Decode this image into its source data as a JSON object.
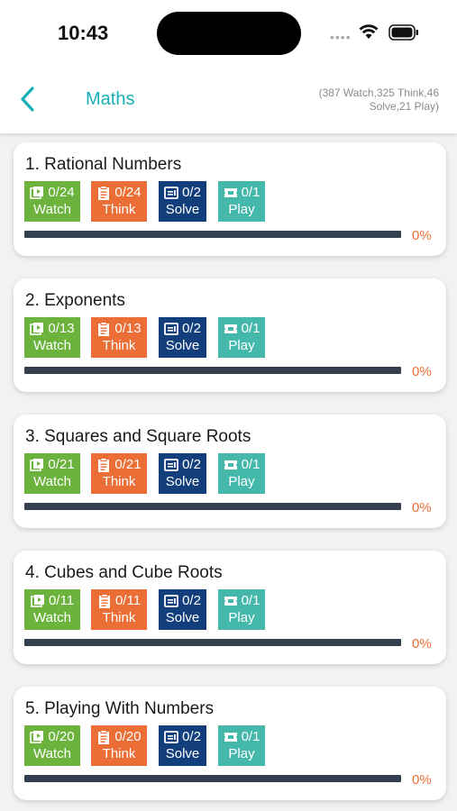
{
  "status": {
    "time": "10:43"
  },
  "header": {
    "title": "Maths",
    "summary_line1": "(387 Watch,325 Think,46",
    "summary_line2": "Solve,21 Play)"
  },
  "chapters": [
    {
      "title": "1. Rational Numbers",
      "watch": "0/24",
      "think": "0/24",
      "solve": "0/2",
      "play": "0/1",
      "progress_text": "0%",
      "progress": 0
    },
    {
      "title": "2. Exponents",
      "watch": "0/13",
      "think": "0/13",
      "solve": "0/2",
      "play": "0/1",
      "progress_text": "0%",
      "progress": 0
    },
    {
      "title": "3. Squares and Square Roots",
      "watch": "0/21",
      "think": "0/21",
      "solve": "0/2",
      "play": "0/1",
      "progress_text": "0%",
      "progress": 0
    },
    {
      "title": "4. Cubes and Cube Roots",
      "watch": "0/11",
      "think": "0/11",
      "solve": "0/2",
      "play": "0/1",
      "progress_text": "0%",
      "progress": 0
    },
    {
      "title": "5. Playing With Numbers",
      "watch": "0/20",
      "think": "0/20",
      "solve": "0/2",
      "play": "0/1",
      "progress_text": "0%",
      "progress": 0
    }
  ],
  "labels": {
    "watch": "Watch",
    "think": "Think",
    "solve": "Solve",
    "play": "Play"
  },
  "icons": {
    "back": "chevron-left-icon",
    "watch": "play-square-icon",
    "think": "clipboard-icon",
    "solve": "screen-icon",
    "play": "ticket-icon"
  },
  "colors": {
    "accent": "#16b0b6",
    "watch": "#6bb33d",
    "think": "#ea6e35",
    "solve": "#123f7c",
    "play": "#45b8ac",
    "progress_track": "#34404f",
    "progress_text": "#ea6e35"
  }
}
